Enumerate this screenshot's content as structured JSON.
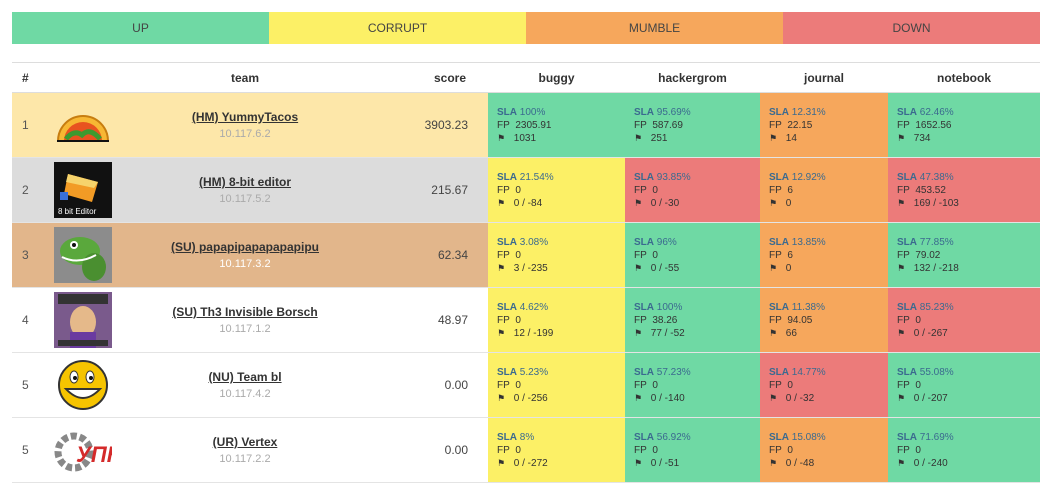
{
  "legend": [
    {
      "label": "UP",
      "cls": "c-up"
    },
    {
      "label": "CORRUPT",
      "cls": "c-corrupt"
    },
    {
      "label": "MUMBLE",
      "cls": "c-mumble"
    },
    {
      "label": "DOWN",
      "cls": "c-down"
    }
  ],
  "headers": {
    "rank": "#",
    "team": "team",
    "score": "score",
    "services": [
      "buggy",
      "hackergrom",
      "journal",
      "notebook"
    ]
  },
  "labels": {
    "sla": "SLA",
    "fp": "FP"
  },
  "colors": {
    "up": "#6fd9a4",
    "corrupt": "#fcf066",
    "mumble": "#f6a75c",
    "down": "#ec7b7a"
  },
  "rows": [
    {
      "rank": "1",
      "name": "(HM) YummyTacos",
      "ip": "10.117.6.2",
      "score": "3903.23",
      "logo": "taco-icon",
      "services": [
        {
          "status": "up",
          "sla": "100%",
          "fp": "2305.91",
          "flags": "1031"
        },
        {
          "status": "up",
          "sla": "95.69%",
          "fp": "587.69",
          "flags": "251"
        },
        {
          "status": "mumble",
          "sla": "12.31%",
          "fp": "22.15",
          "flags": "14"
        },
        {
          "status": "up",
          "sla": "62.46%",
          "fp": "1652.56",
          "flags": "734"
        }
      ]
    },
    {
      "rank": "2",
      "name": "(HM) 8-bit editor",
      "ip": "10.117.5.2",
      "score": "215.67",
      "logo": "8bit-editor-icon",
      "logo_text": "8 bit Editor",
      "services": [
        {
          "status": "corrupt",
          "sla": "21.54%",
          "fp": "0",
          "flags": "0 / -84"
        },
        {
          "status": "down",
          "sla": "93.85%",
          "fp": "0",
          "flags": "0 / -30"
        },
        {
          "status": "mumble",
          "sla": "12.92%",
          "fp": "6",
          "flags": "0"
        },
        {
          "status": "down",
          "sla": "47.38%",
          "fp": "453.52",
          "flags": "169 / -103"
        }
      ]
    },
    {
      "rank": "3",
      "name": "(SU) papapipapapapapipu",
      "ip": "10.117.3.2",
      "score": "62.34",
      "logo": "lizard-icon",
      "services": [
        {
          "status": "corrupt",
          "sla": "3.08%",
          "fp": "0",
          "flags": "3 / -235"
        },
        {
          "status": "up",
          "sla": "96%",
          "fp": "0",
          "flags": "0 / -55"
        },
        {
          "status": "mumble",
          "sla": "13.85%",
          "fp": "6",
          "flags": "0"
        },
        {
          "status": "up",
          "sla": "77.85%",
          "fp": "79.02",
          "flags": "132 / -218"
        }
      ]
    },
    {
      "rank": "4",
      "name": "(SU) Th3 Invisible Borsch",
      "ip": "10.117.1.2",
      "score": "48.97",
      "logo": "meme-icon",
      "services": [
        {
          "status": "corrupt",
          "sla": "4.62%",
          "fp": "0",
          "flags": "12 / -199"
        },
        {
          "status": "up",
          "sla": "100%",
          "fp": "38.26",
          "flags": "77 / -52"
        },
        {
          "status": "mumble",
          "sla": "11.38%",
          "fp": "94.05",
          "flags": "66"
        },
        {
          "status": "down",
          "sla": "85.23%",
          "fp": "0",
          "flags": "0 / -267"
        }
      ]
    },
    {
      "rank": "5",
      "name": "(NU) Team bl",
      "ip": "10.117.4.2",
      "score": "0.00",
      "logo": "smiley-icon",
      "services": [
        {
          "status": "corrupt",
          "sla": "5.23%",
          "fp": "0",
          "flags": "0 / -256"
        },
        {
          "status": "up",
          "sla": "57.23%",
          "fp": "0",
          "flags": "0 / -140"
        },
        {
          "status": "down",
          "sla": "14.77%",
          "fp": "0",
          "flags": "0 / -32"
        },
        {
          "status": "up",
          "sla": "55.08%",
          "fp": "0",
          "flags": "0 / -207"
        }
      ]
    },
    {
      "rank": "5",
      "name": "(UR) Vertex",
      "ip": "10.117.2.2",
      "score": "0.00",
      "logo": "upk-icon",
      "logo_text": "УПК",
      "services": [
        {
          "status": "corrupt",
          "sla": "8%",
          "fp": "0",
          "flags": "0 / -272"
        },
        {
          "status": "up",
          "sla": "56.92%",
          "fp": "0",
          "flags": "0 / -51"
        },
        {
          "status": "mumble",
          "sla": "15.08%",
          "fp": "0",
          "flags": "0 / -48"
        },
        {
          "status": "up",
          "sla": "71.69%",
          "fp": "0",
          "flags": "0 / -240"
        }
      ]
    }
  ]
}
